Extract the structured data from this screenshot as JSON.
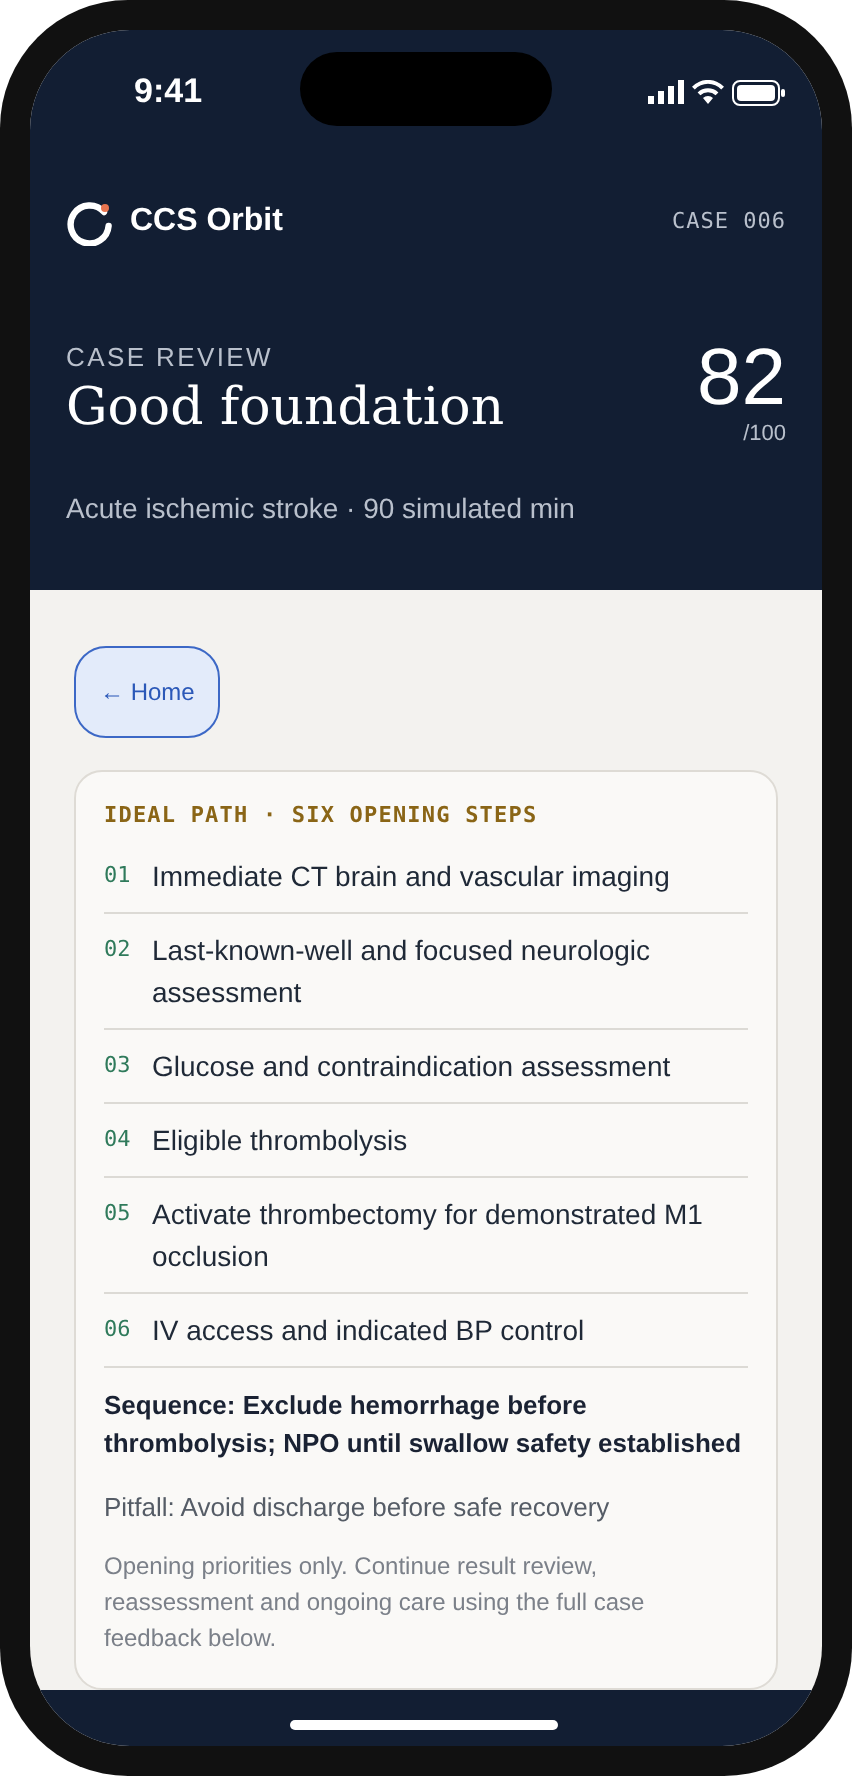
{
  "status_bar": {
    "time": "9:41"
  },
  "header": {
    "brand": "CCS Orbit",
    "case_id": "CASE 006"
  },
  "review": {
    "eyebrow": "CASE REVIEW",
    "title": "Good foundation",
    "score": "82",
    "score_max": "/100",
    "subtitle": "Acute ischemic stroke · 90 simulated min"
  },
  "back_button": {
    "label": "← Home"
  },
  "ideal_path": {
    "heading": "IDEAL PATH · SIX OPENING STEPS",
    "steps": [
      {
        "number": "01",
        "text": "Immediate CT brain and vascular imaging"
      },
      {
        "number": "02",
        "text": "Last-known-well and focused neurologic assessment"
      },
      {
        "number": "03",
        "text": "Glucose and contraindication assessment"
      },
      {
        "number": "04",
        "text": "Eligible thrombolysis"
      },
      {
        "number": "05",
        "text": "Activate thrombectomy for demonstrated M1 occlusion"
      },
      {
        "number": "06",
        "text": "IV access and indicated BP control"
      }
    ],
    "sequence": "Sequence: Exclude hemorrhage before thrombolysis; NPO until swallow safety established",
    "pitfall": "Pitfall: Avoid discharge before safe recovery",
    "note": "Opening priorities only. Continue result review, reassessment and ongoing care using the full case feedback below."
  }
}
